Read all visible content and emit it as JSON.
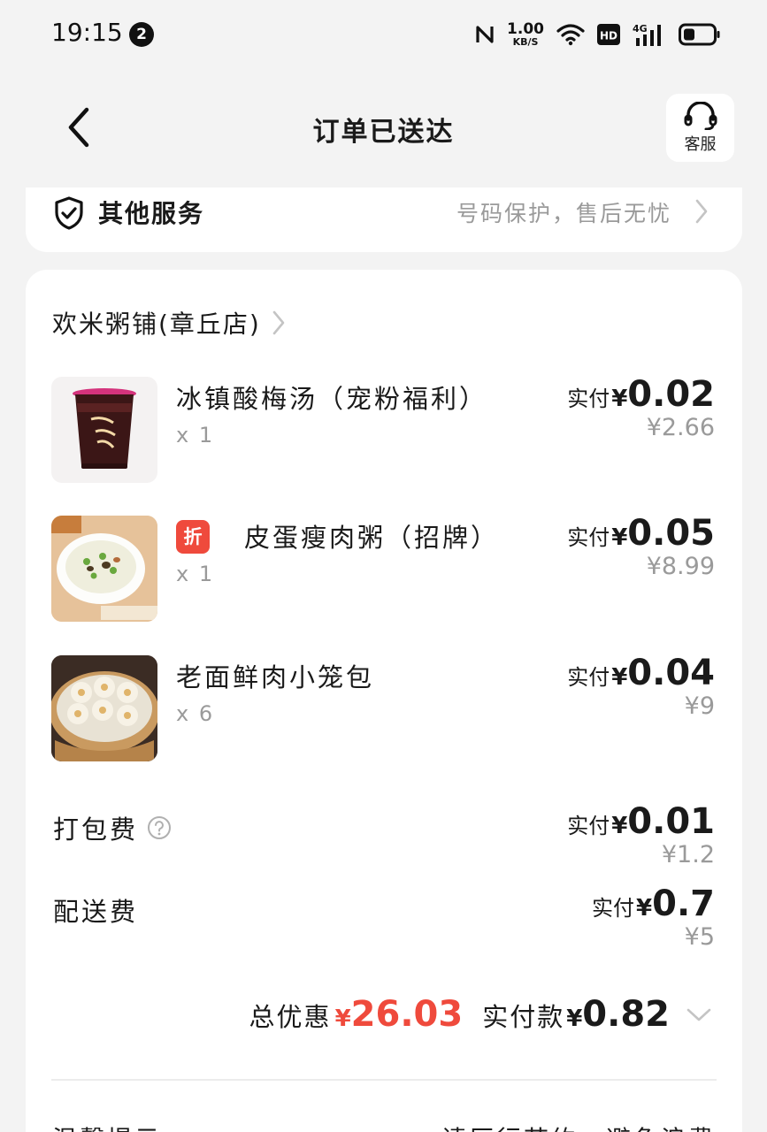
{
  "status_bar": {
    "time": "19:15",
    "notification_count": "2",
    "speed_value": "1.00",
    "speed_unit": "KB/S",
    "hd_label": "HD",
    "network_label": "4G"
  },
  "header": {
    "title": "订单已送达",
    "customer_service_label": "客服"
  },
  "services": {
    "title": "其他服务",
    "description": "号码保护，售后无忧"
  },
  "store": {
    "name": "欢米粥铺(章丘店)"
  },
  "items": [
    {
      "name": "冰镇酸梅汤（宠粉福利）",
      "quantity": "x 1",
      "paid_label": "实付",
      "currency": "¥",
      "paid": "0.02",
      "original": "¥2.66",
      "thumb_icon": "sour-plum-drink-cup"
    },
    {
      "name": "皮蛋瘦肉粥（招牌）",
      "quantity": "x 1",
      "discount_tag": "折",
      "paid_label": "实付",
      "currency": "¥",
      "paid": "0.05",
      "original": "¥8.99",
      "thumb_icon": "congee-bowl"
    },
    {
      "name": "老面鲜肉小笼包",
      "quantity": "x 6",
      "paid_label": "实付",
      "currency": "¥",
      "paid": "0.04",
      "original": "¥9",
      "thumb_icon": "steamed-buns-basket"
    }
  ],
  "fees": [
    {
      "label": "打包费",
      "paid_label": "实付",
      "currency": "¥",
      "paid": "0.01",
      "original": "¥1.2"
    },
    {
      "label": "配送费",
      "paid_label": "实付",
      "currency": "¥",
      "paid": "0.7",
      "original": "¥5"
    }
  ],
  "totals": {
    "discount_label": "总优惠",
    "currency": "¥",
    "discount": "26.03",
    "paid_label": "实付款",
    "paid": "0.82"
  },
  "tips": {
    "title": "温馨提示",
    "text": "请厉行节约，避免浪费"
  },
  "colors": {
    "accent_red": "#ef4a3c",
    "muted_text": "#9a9a9a",
    "background": "#f3f3f3"
  }
}
